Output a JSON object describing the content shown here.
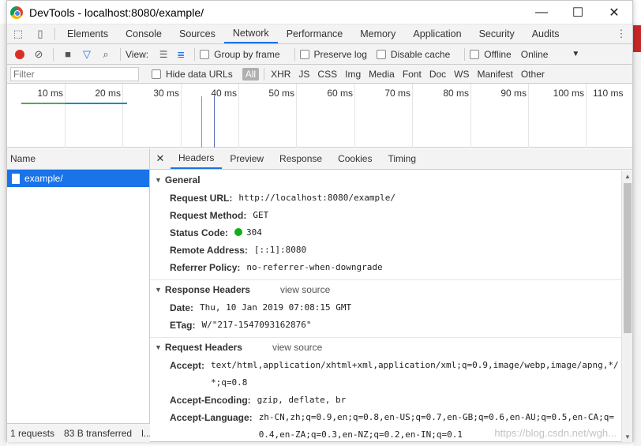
{
  "window": {
    "title": "DevTools - localhost:8080/example/",
    "minimize": "—",
    "maximize": "☐",
    "close": "✕"
  },
  "tabs": [
    "Elements",
    "Console",
    "Sources",
    "Network",
    "Performance",
    "Memory",
    "Application",
    "Security",
    "Audits"
  ],
  "active_tab": "Network",
  "toolbar": {
    "view_label": "View:",
    "group_by_frame": "Group by frame",
    "preserve_log": "Preserve log",
    "disable_cache": "Disable cache",
    "offline": "Offline",
    "online": "Online"
  },
  "filterbar": {
    "placeholder": "Filter",
    "hide_data_urls": "Hide data URLs",
    "types": [
      "All",
      "XHR",
      "JS",
      "CSS",
      "Img",
      "Media",
      "Font",
      "Doc",
      "WS",
      "Manifest",
      "Other"
    ]
  },
  "overview": {
    "ticks": [
      "10 ms",
      "20 ms",
      "30 ms",
      "40 ms",
      "50 ms",
      "60 ms",
      "70 ms",
      "80 ms",
      "90 ms",
      "100 ms",
      "110 ms"
    ]
  },
  "requests": {
    "column": "Name",
    "items": [
      "example/"
    ],
    "summary_count": "1 requests",
    "summary_transferred": "83 B transferred",
    "summary_more": "l..."
  },
  "subtabs": [
    "Headers",
    "Preview",
    "Response",
    "Cookies",
    "Timing"
  ],
  "active_subtab": "Headers",
  "general": {
    "title": "General",
    "rows": [
      {
        "k": "Request URL:",
        "v": "http://localhost:8080/example/"
      },
      {
        "k": "Request Method:",
        "v": "GET"
      },
      {
        "k": "Status Code:",
        "v": "304"
      },
      {
        "k": "Remote Address:",
        "v": "[::1]:8080"
      },
      {
        "k": "Referrer Policy:",
        "v": "no-referrer-when-downgrade"
      }
    ]
  },
  "response_headers": {
    "title": "Response Headers",
    "view_source": "view source",
    "rows": [
      {
        "k": "Date:",
        "v": "Thu, 10 Jan 2019 07:08:15 GMT"
      },
      {
        "k": "ETag:",
        "v": "W/\"217-1547093162876\""
      }
    ]
  },
  "request_headers": {
    "title": "Request Headers",
    "view_source": "view source",
    "rows": [
      {
        "k": "Accept:",
        "v": "text/html,application/xhtml+xml,application/xml;q=0.9,image/webp,image/apng,*/*;q=0.8"
      },
      {
        "k": "Accept-Encoding:",
        "v": "gzip, deflate, br"
      },
      {
        "k": "Accept-Language:",
        "v": "zh-CN,zh;q=0.9,en;q=0.8,en-US;q=0.7,en-GB;q=0.6,en-AU;q=0.5,en-CA;q=0.4,en-ZA;q=0.3,en-NZ;q=0.2,en-IN;q=0.1"
      }
    ]
  },
  "watermark": "https://blog.csdn.net/wgh..."
}
